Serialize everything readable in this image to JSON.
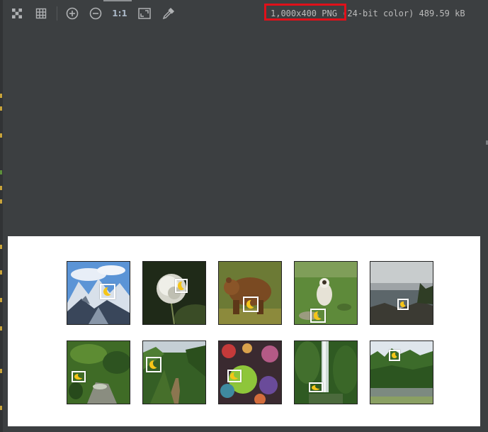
{
  "toolbar": {
    "icons": [
      "checkerboard-icon",
      "grid-icon",
      "zoom-in-icon",
      "zoom-out-icon",
      "actual-size-icon",
      "fit-screen-icon",
      "color-picker-icon"
    ],
    "actual_size_label": "1:1"
  },
  "image_info": {
    "dimensions_format": "1,000x400 PNG",
    "color_depth": "(24-bit color)",
    "file_size": "489.59 kB"
  },
  "highlight_color": "#e0101a",
  "canvas": {
    "background": "#ffffff",
    "rows": [
      [
        {
          "scene": "snowy mountains and glacial valley",
          "marker": "moon-icon"
        },
        {
          "scene": "dandelion seed head",
          "marker": "moon-icon"
        },
        {
          "scene": "brown bear on grass",
          "marker": "moon-icon"
        },
        {
          "scene": "marmot on grassy slope",
          "marker": "moon-icon"
        },
        {
          "scene": "misty rocky shoreline",
          "marker": "moon-icon"
        }
      ],
      [
        {
          "scene": "forest stream",
          "marker": "moon-icon"
        },
        {
          "scene": "river valley through green forest",
          "marker": "moon-icon"
        },
        {
          "scene": "colorful coral reef",
          "marker": "moon-icon"
        },
        {
          "scene": "waterfall in dense forest",
          "marker": "moon-icon"
        },
        {
          "scene": "forested lakeshore",
          "marker": "moon-icon"
        }
      ]
    ]
  }
}
